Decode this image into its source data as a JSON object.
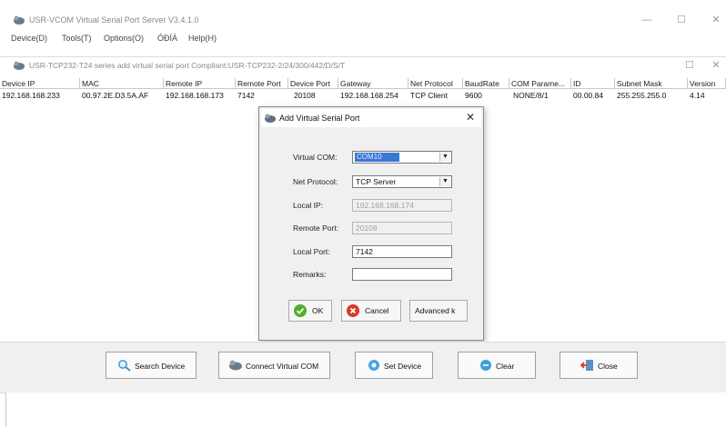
{
  "window": {
    "title": "USR-VCOM Virtual Serial Port Server V3.4.1.0",
    "minimize": "—",
    "maximize": "☐",
    "close": "✕"
  },
  "menu": [
    "Device(D)",
    "Tools(T)",
    "Options(O)",
    "ÓÐÍÁ",
    "Help(H)"
  ],
  "inner_window": {
    "title": "USR-TCP232-T24 series add virtual serial port  Compliant:USR-TCP232-2/24/300/442/D/S/T",
    "maximize": "☐",
    "close": "✕"
  },
  "table": {
    "headers": [
      "Device IP",
      "MAC",
      "Remote IP",
      "Remote Port",
      "Device Port",
      "Gateway",
      "Net Protocol",
      "BaudRate",
      "COM Parame...",
      "ID",
      "Subnet Mask",
      "Version"
    ],
    "rows": [
      [
        "192.168.168.233",
        "00.97.2E.D3.5A.AF",
        "192.168.168.173",
        "7142",
        "20108",
        "192.168.168.254",
        "TCP Client",
        "9600",
        "NONE/8/1",
        "00.00.84",
        "255.255.255.0",
        "4.14"
      ]
    ]
  },
  "dialog": {
    "title": "Add Virtual Serial Port",
    "close": "✕",
    "labels": {
      "virtual_com": "Virtual COM:",
      "net_protocol": "Net Protocol:",
      "local_ip": "Local IP:",
      "remote_port": "Remote Port:",
      "local_port": "Local Port:",
      "remarks": "Remarks:"
    },
    "values": {
      "virtual_com": "COM10",
      "net_protocol": "TCP Server",
      "local_ip": "192.168.168.174",
      "remote_port": "20108",
      "local_port": "7142",
      "remarks": ""
    },
    "buttons": {
      "ok": "OK",
      "cancel": "Cancel",
      "advanced": "Advanced  k"
    }
  },
  "toolbar": {
    "search": "Search Device",
    "connect": "Connect Virtual COM",
    "set": "Set Device",
    "clear": "Clear",
    "close": "Close"
  },
  "colors": {
    "selection": "#3a78d6",
    "ok_icon": "#4caf2a",
    "cancel_icon": "#d9392c"
  }
}
